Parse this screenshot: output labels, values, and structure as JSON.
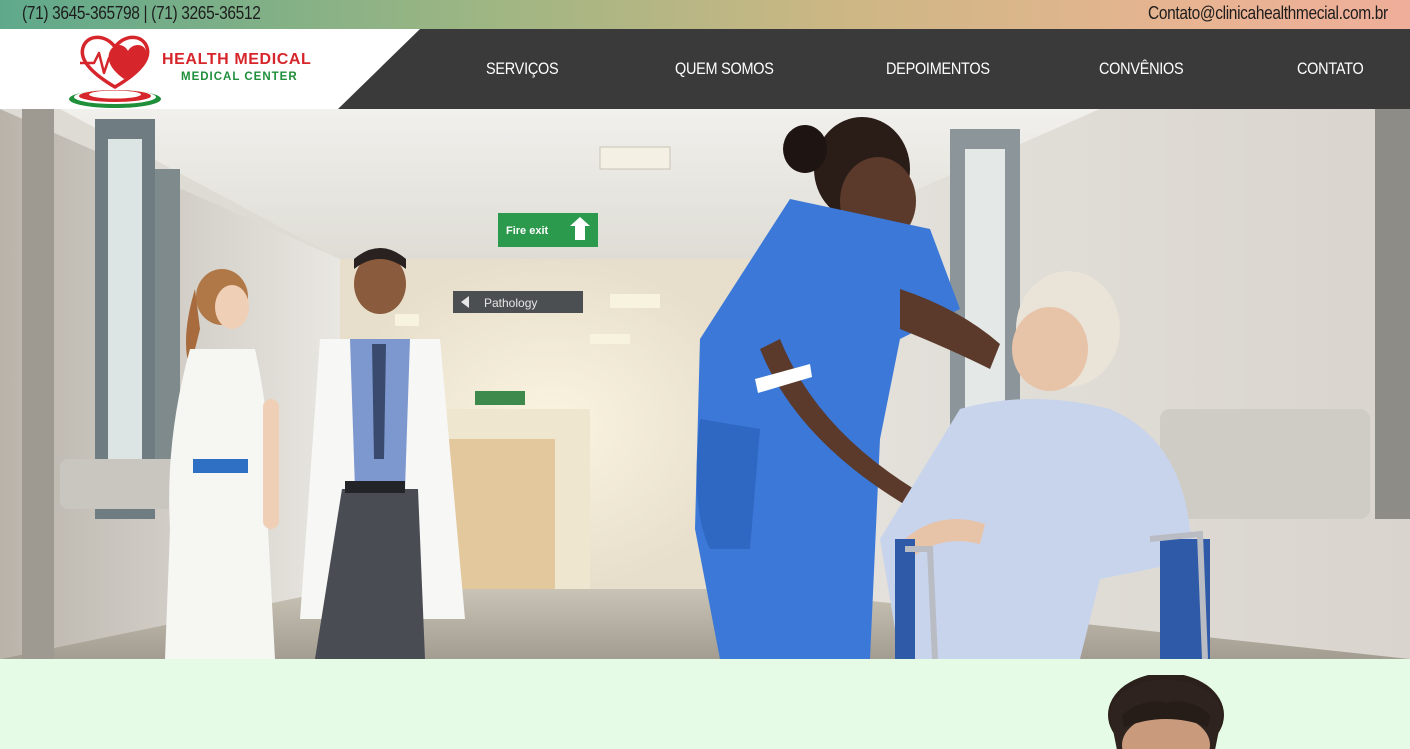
{
  "topbar": {
    "phones": "(71) 3645-365798 | (71) 3265-36512",
    "email": "Contato@clinicahealthmecial.com.br"
  },
  "brand": {
    "title": "HEALTH MEDICAL",
    "subtitle": "MEDICAL CENTER",
    "icon": "heart-logo-icon",
    "colors": {
      "red": "#d6262b",
      "green": "#1f8f3a"
    }
  },
  "nav": {
    "items": [
      {
        "label": "SERVIÇOS"
      },
      {
        "label": "QUEM SOMOS"
      },
      {
        "label": "DEPOIMENTOS"
      },
      {
        "label": "CONVÊNIOS"
      },
      {
        "label": "CONTATO"
      }
    ]
  },
  "hero": {
    "signs": {
      "fire_exit": "Fire exit",
      "pathology": "Pathology"
    }
  },
  "theme": {
    "header_bg": "#3a3a3a",
    "section_bg": "#e6fbe6",
    "nav_text": "#ffffff"
  }
}
